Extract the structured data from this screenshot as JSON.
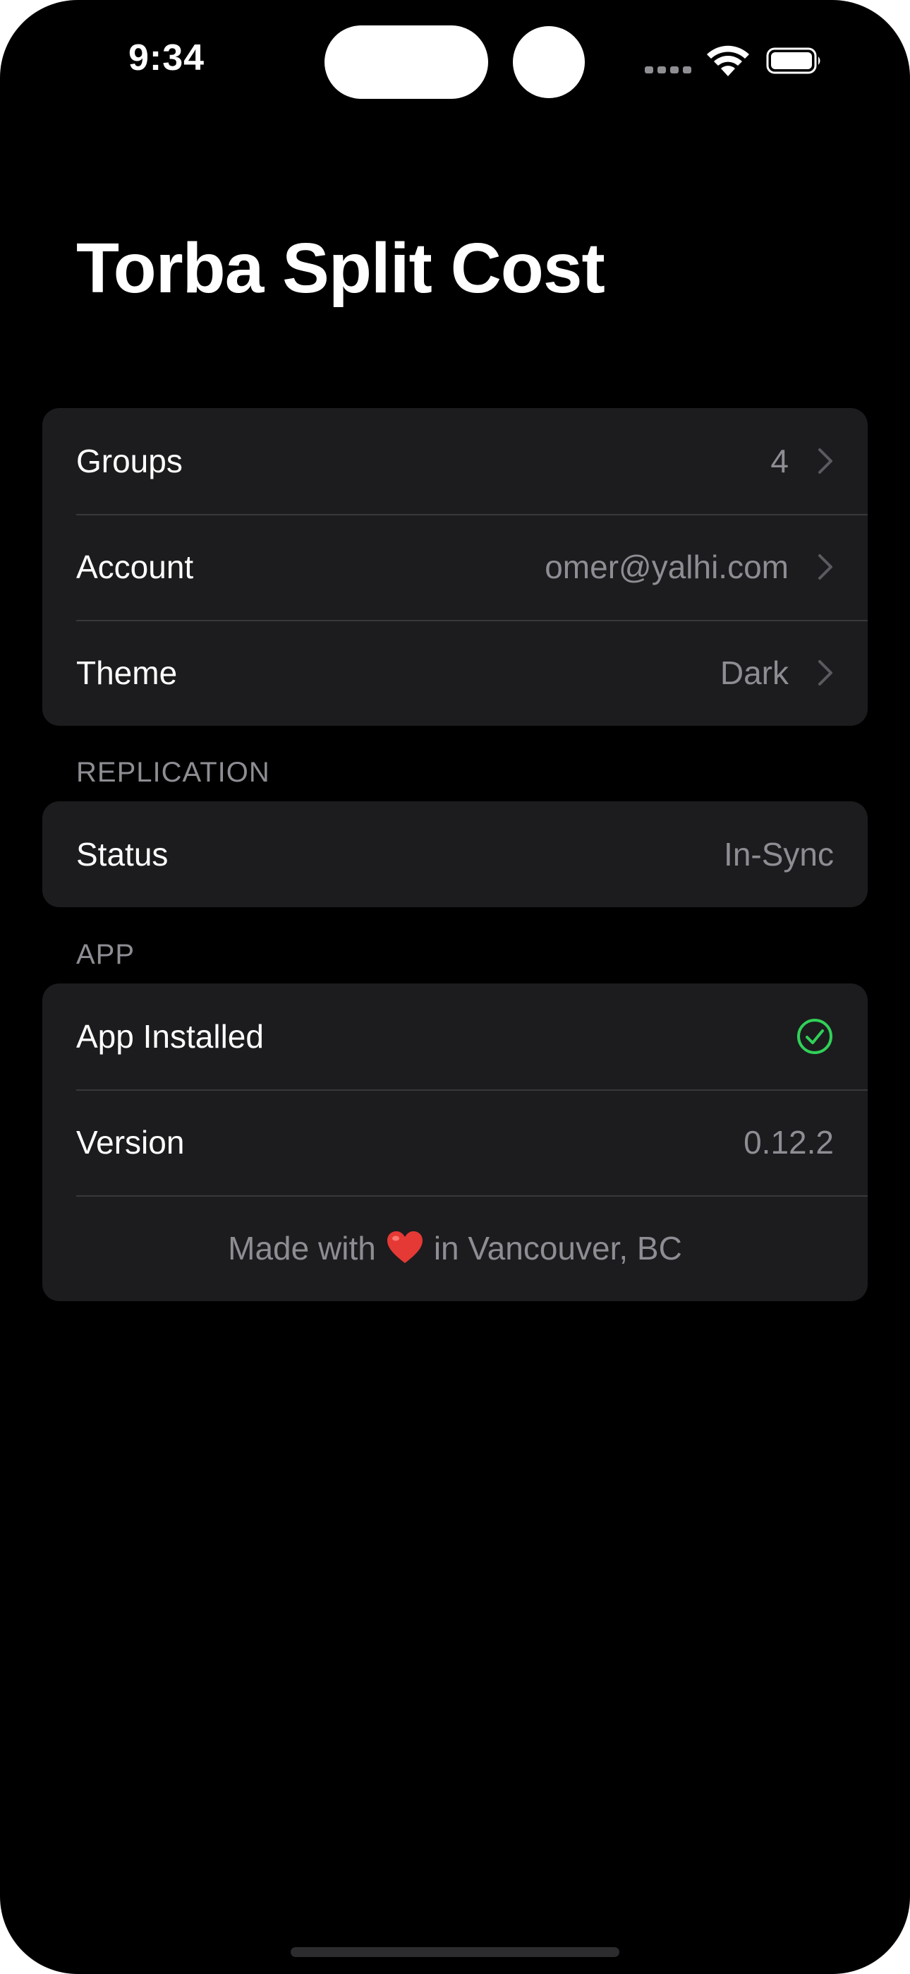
{
  "status_bar": {
    "time": "9:34"
  },
  "page": {
    "title": "Torba Split Cost"
  },
  "settings": {
    "main_rows": [
      {
        "label": "Groups",
        "value": "4"
      },
      {
        "label": "Account",
        "value": "omer@yalhi.com"
      },
      {
        "label": "Theme",
        "value": "Dark"
      }
    ],
    "replication": {
      "header": "REPLICATION",
      "status_label": "Status",
      "status_value": "In-Sync"
    },
    "app": {
      "header": "APP",
      "installed_label": "App Installed",
      "installed_icon": "checkmark-circle-icon",
      "version_label": "Version",
      "version_value": "0.12.2",
      "footer_before": "Made with",
      "footer_after": "in Vancouver, BC"
    }
  },
  "colors": {
    "background": "#000000",
    "card": "#1c1c1e",
    "secondary_text": "#8d8d93",
    "success": "#30d158",
    "heart": "#e53935"
  }
}
